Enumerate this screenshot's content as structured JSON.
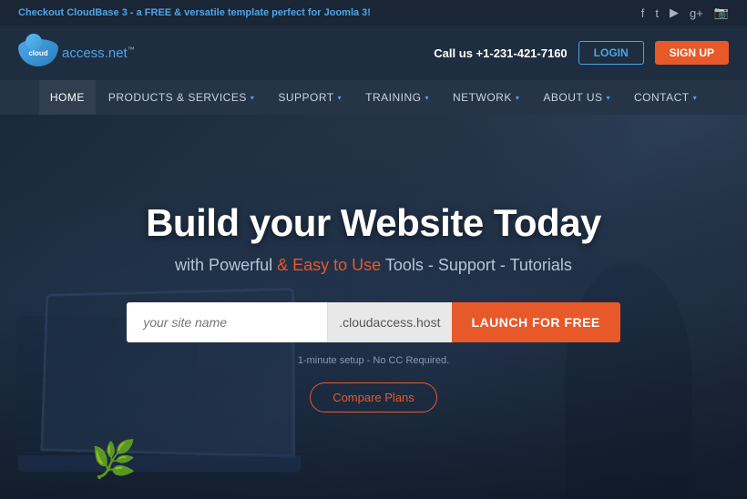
{
  "topbar": {
    "announcement": "Checkout ",
    "brand": "CloudBase 3",
    "announcement_suffix": " - a FREE & versatile template perfect for Joomla 3!",
    "icons": [
      "facebook",
      "twitter",
      "youtube",
      "google-plus",
      "instagram"
    ]
  },
  "header": {
    "logo_cloud": "cloud",
    "logo_domain": "access.net",
    "logo_tm": "™",
    "call_label": "Call us",
    "phone": "+1-231-421-7160",
    "login_label": "LOGIN",
    "signup_label": "SIGN UP"
  },
  "nav": {
    "items": [
      {
        "label": "HOME",
        "dropdown": false,
        "active": true
      },
      {
        "label": "PRODUCTS & SERVICES",
        "dropdown": true,
        "active": false
      },
      {
        "label": "SUPPORT",
        "dropdown": true,
        "active": false
      },
      {
        "label": "TRAINING",
        "dropdown": true,
        "active": false
      },
      {
        "label": "NETWORK",
        "dropdown": true,
        "active": false
      },
      {
        "label": "ABOUT US",
        "dropdown": true,
        "active": false
      },
      {
        "label": "CONTACT",
        "dropdown": true,
        "active": false
      }
    ]
  },
  "hero": {
    "title": "Build your Website Today",
    "subtitle_prefix": "with Powerful",
    "subtitle_highlight": "& Easy to Use",
    "subtitle_suffix": "Tools - Support - Tutorials",
    "search_placeholder": "your site name",
    "domain_suffix": ".cloudaccess.host",
    "launch_label": "LAUNCH FOR FREE",
    "setup_note": "1-minute setup - No CC Required.",
    "compare_label": "Compare Plans"
  },
  "colors": {
    "accent": "#e8592a",
    "blue": "#4da6e8",
    "dark_bg": "#1e2d40",
    "nav_bg": "#253447"
  }
}
